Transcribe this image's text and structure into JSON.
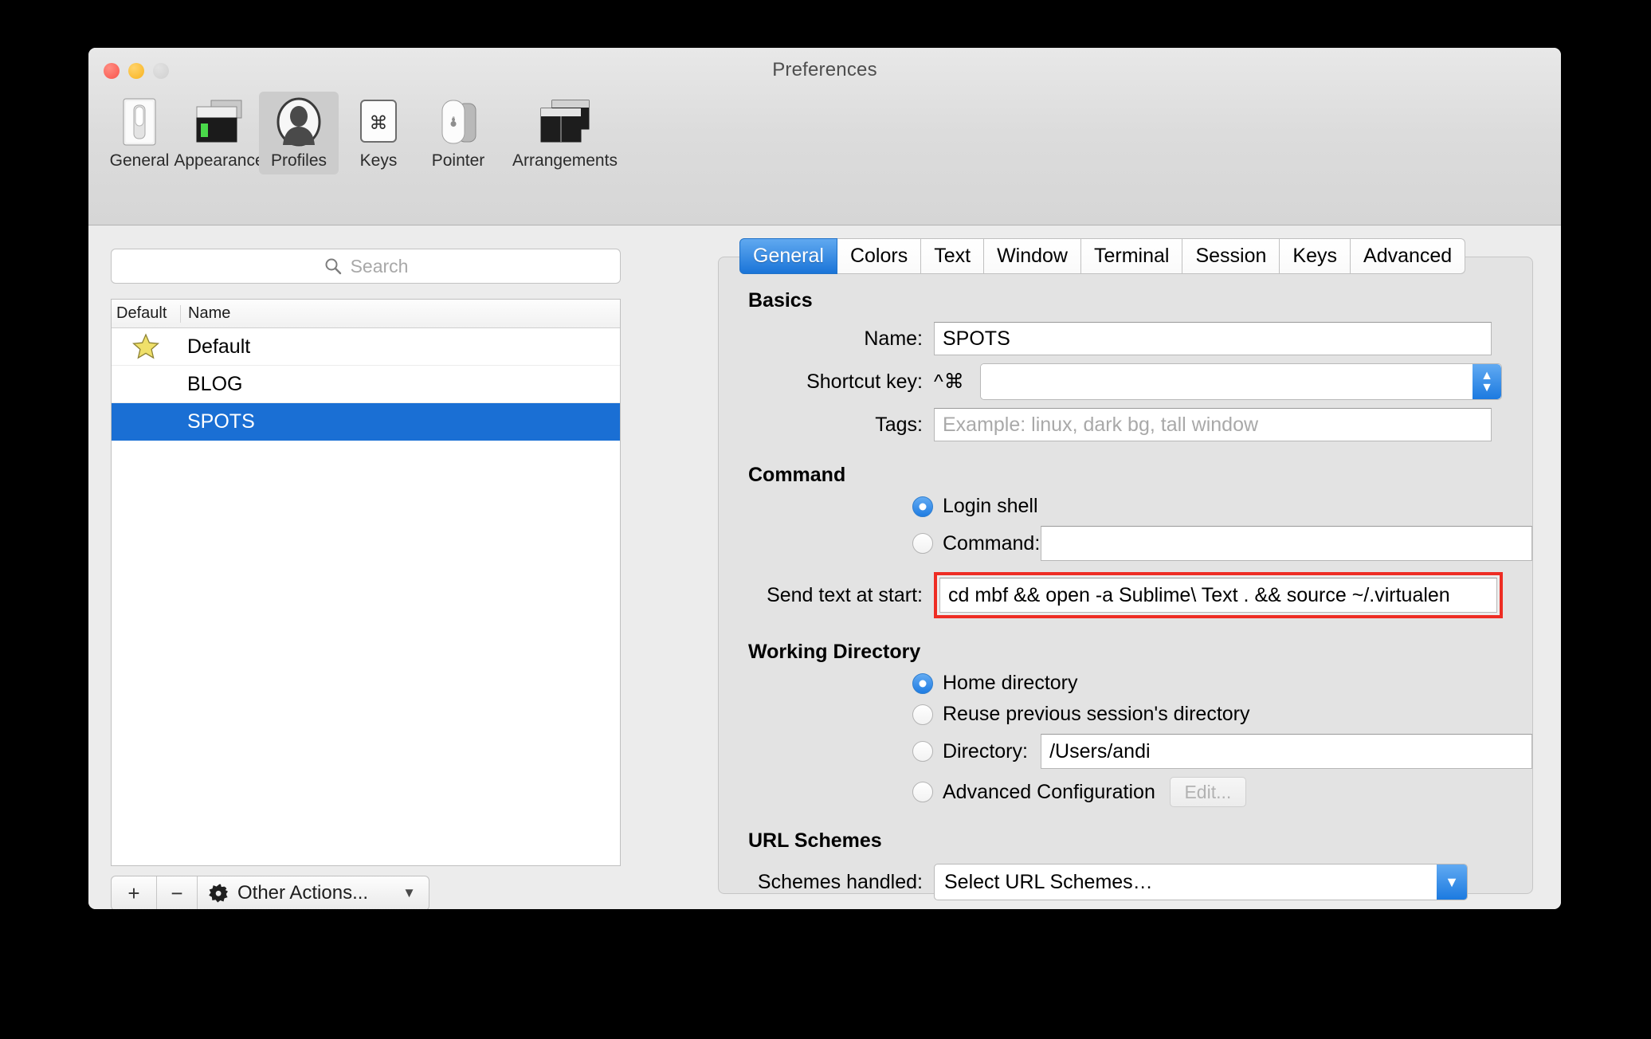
{
  "window": {
    "title": "Preferences",
    "traffic_lights": [
      "close-red",
      "minimize-yellow",
      "zoom-grey-disabled"
    ]
  },
  "toolbar": {
    "items": [
      {
        "label": "General",
        "icon": "general-switch-icon",
        "selected": false
      },
      {
        "label": "Appearance",
        "icon": "appearance-window-icon",
        "selected": false
      },
      {
        "label": "Profiles",
        "icon": "profiles-person-icon",
        "selected": true
      },
      {
        "label": "Keys",
        "icon": "keys-command-key-icon",
        "selected": false
      },
      {
        "label": "Pointer",
        "icon": "pointer-mouse-icon",
        "selected": false
      },
      {
        "label": "Arrangements",
        "icon": "arrangements-windows-icon",
        "selected": false
      }
    ]
  },
  "sidebar": {
    "search": {
      "placeholder": "Search",
      "value": "",
      "icon": "search-icon"
    },
    "columns": [
      "Default",
      "Name"
    ],
    "rows": [
      {
        "name": "Default",
        "is_default": true,
        "selected": false,
        "star_icon": "star-icon"
      },
      {
        "name": "BLOG",
        "is_default": false,
        "selected": false
      },
      {
        "name": "SPOTS",
        "is_default": false,
        "selected": true
      }
    ],
    "toolbar": {
      "add_label": "+",
      "remove_label": "−",
      "other_actions_label": "Other Actions...",
      "gear_icon": "gear-icon",
      "caret_icon": "chevron-down-icon"
    }
  },
  "tabs": [
    {
      "label": "General",
      "active": true
    },
    {
      "label": "Colors",
      "active": false
    },
    {
      "label": "Text",
      "active": false
    },
    {
      "label": "Window",
      "active": false
    },
    {
      "label": "Terminal",
      "active": false
    },
    {
      "label": "Session",
      "active": false
    },
    {
      "label": "Keys",
      "active": false
    },
    {
      "label": "Advanced",
      "active": false
    }
  ],
  "general_tab": {
    "basics": {
      "heading": "Basics",
      "name_label": "Name:",
      "name_value": "SPOTS",
      "shortcut_label": "Shortcut key:",
      "shortcut_modifier": "^⌘",
      "shortcut_value": "",
      "stepper_up_icon": "chevron-up-icon",
      "stepper_down_icon": "chevron-down-icon",
      "tags_label": "Tags:",
      "tags_value": "",
      "tags_placeholder": "Example: linux, dark bg, tall window"
    },
    "command": {
      "heading": "Command",
      "login_shell_label": "Login shell",
      "login_shell_selected": true,
      "command_label": "Command:",
      "command_selected": false,
      "command_value": "",
      "send_text_label": "Send text at start:",
      "send_text_value": "cd mbf && open -a Sublime\\ Text . && source ~/.virtualen",
      "send_text_highlight_color": "#ee2d24"
    },
    "working_directory": {
      "heading": "Working Directory",
      "home_label": "Home directory",
      "home_selected": true,
      "reuse_label": "Reuse previous session's directory",
      "reuse_selected": false,
      "directory_label": "Directory:",
      "directory_selected": false,
      "directory_value": "/Users/andi",
      "advanced_label": "Advanced Configuration",
      "advanced_selected": false,
      "edit_button_label": "Edit..."
    },
    "url_schemes": {
      "heading": "URL Schemes",
      "schemes_label": "Schemes handled:",
      "schemes_value": "Select URL Schemes…",
      "schemes_arrow_icon": "chevron-down-icon"
    }
  },
  "colors": {
    "accent_blue": "#1a74d8",
    "selection_blue": "#1a6fd4",
    "highlight_red": "#ee2d24",
    "window_bg": "#ececec",
    "panel_bg": "#e3e3e3"
  }
}
